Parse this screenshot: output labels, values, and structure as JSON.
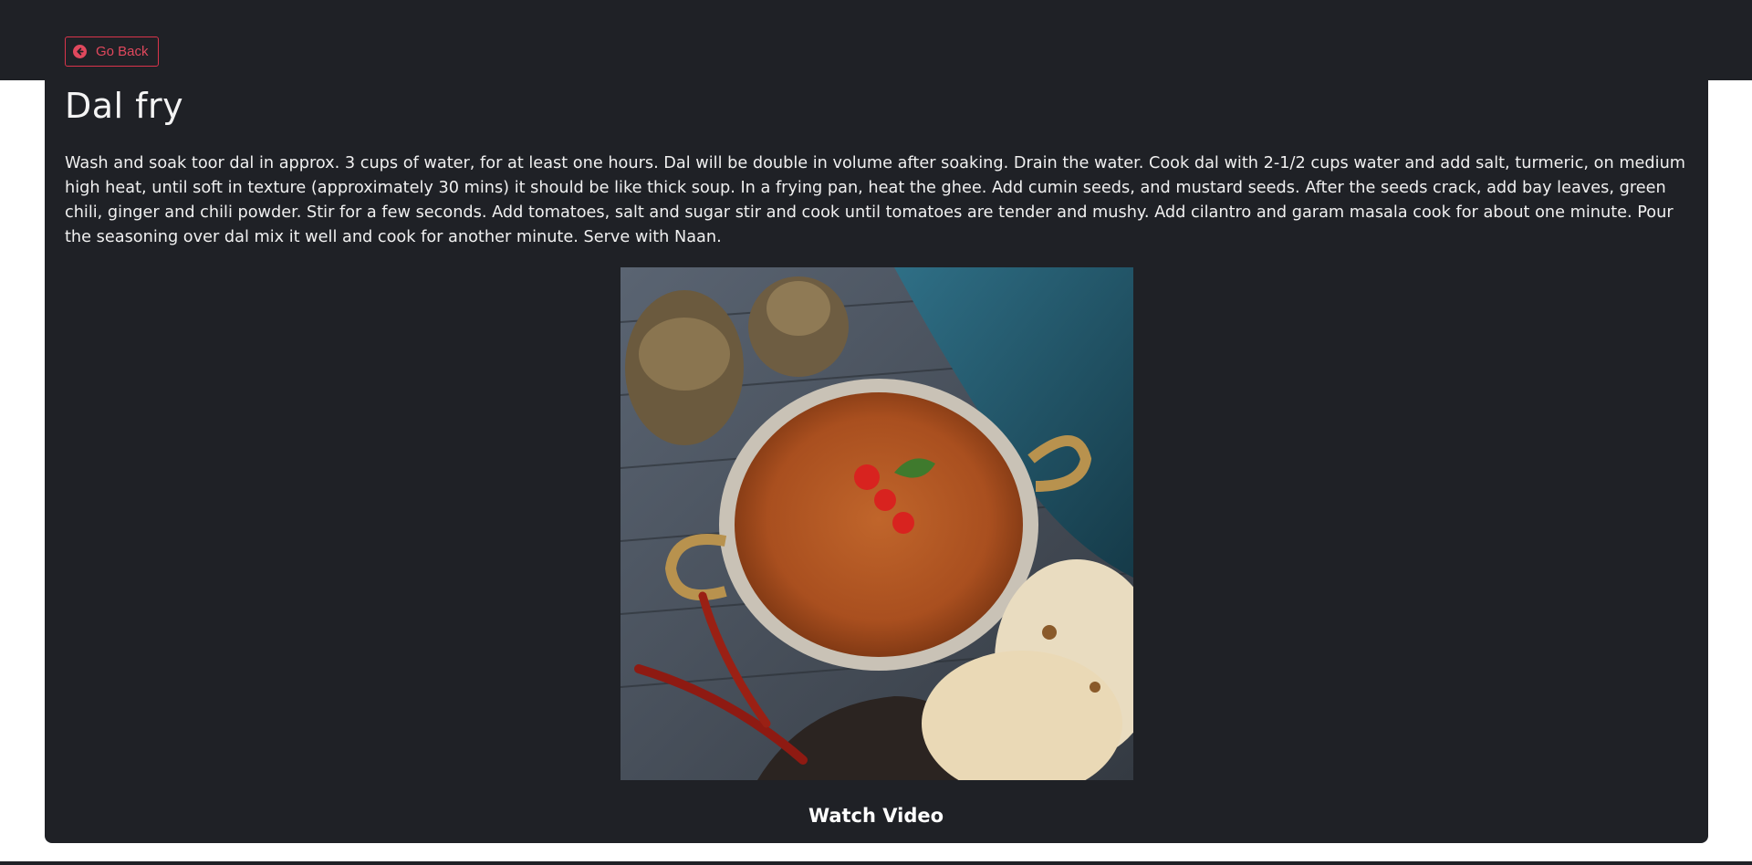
{
  "nav": {
    "back_label": "Go Back"
  },
  "recipe": {
    "title": "Dal fry",
    "description": "Wash and soak toor dal in approx. 3 cups of water, for at least one hours. Dal will be double in volume after soaking. Drain the water. Cook dal with 2-1/2 cups water and add salt, turmeric, on medium high heat, until soft in texture (approximately 30 mins) it should be like thick soup. In a frying pan, heat the ghee. Add cumin seeds, and mustard seeds. After the seeds crack, add bay leaves, green chili, ginger and chili powder. Stir for a few seconds. Add tomatoes, salt and sugar stir and cook until tomatoes are tender and mushy. Add cilantro and garam masala cook for about one minute. Pour the seasoning over dal mix it well and cook for another minute. Serve with Naan.",
    "video_label": "Watch Video"
  },
  "colors": {
    "background": "#1f2126",
    "accent": "#e0485d",
    "text": "#f0f0f0"
  },
  "icons": {
    "back": "arrow-left-circle-icon"
  }
}
